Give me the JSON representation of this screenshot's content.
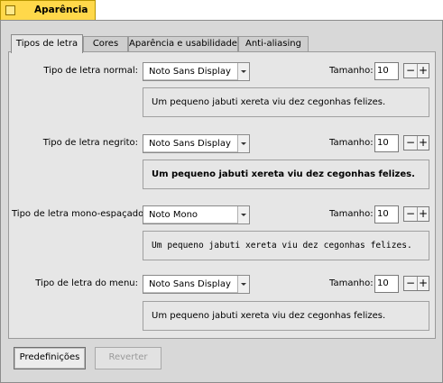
{
  "window": {
    "title": "Aparência"
  },
  "tabs": [
    {
      "label": "Tipos de letra",
      "active": true
    },
    {
      "label": "Cores",
      "active": false
    },
    {
      "label": "Aparência e usabilidade",
      "active": false
    },
    {
      "label": "Anti-aliasing",
      "active": false
    }
  ],
  "fonts": [
    {
      "label": "Tipo de letra normal:",
      "family": "Noto Sans Display",
      "size_label": "Tamanho:",
      "size": "10",
      "preview": "Um pequeno jabuti xereta viu dez cegonhas felizes."
    },
    {
      "label": "Tipo de letra negrito:",
      "family": "Noto Sans Display",
      "size_label": "Tamanho:",
      "size": "10",
      "preview": "Um pequeno jabuti xereta viu dez cegonhas felizes."
    },
    {
      "label": "Tipo de letra mono-espaçado:",
      "family": "Noto Mono",
      "size_label": "Tamanho:",
      "size": "10",
      "preview": "Um pequeno jabuti xereta viu dez cegonhas felizes."
    },
    {
      "label": "Tipo de letra do menu:",
      "family": "Noto Sans Display",
      "size_label": "Tamanho:",
      "size": "10",
      "preview": "Um pequeno jabuti xereta viu dez cegonhas felizes."
    }
  ],
  "stepper": {
    "minus": "−",
    "plus": "+"
  },
  "buttons": {
    "defaults": "Predefinições",
    "revert": "Reverter"
  },
  "colors": {
    "title_tab": "#ffd84a",
    "window_bg": "#d8d8d8",
    "panel_bg": "#e6e6e6"
  }
}
